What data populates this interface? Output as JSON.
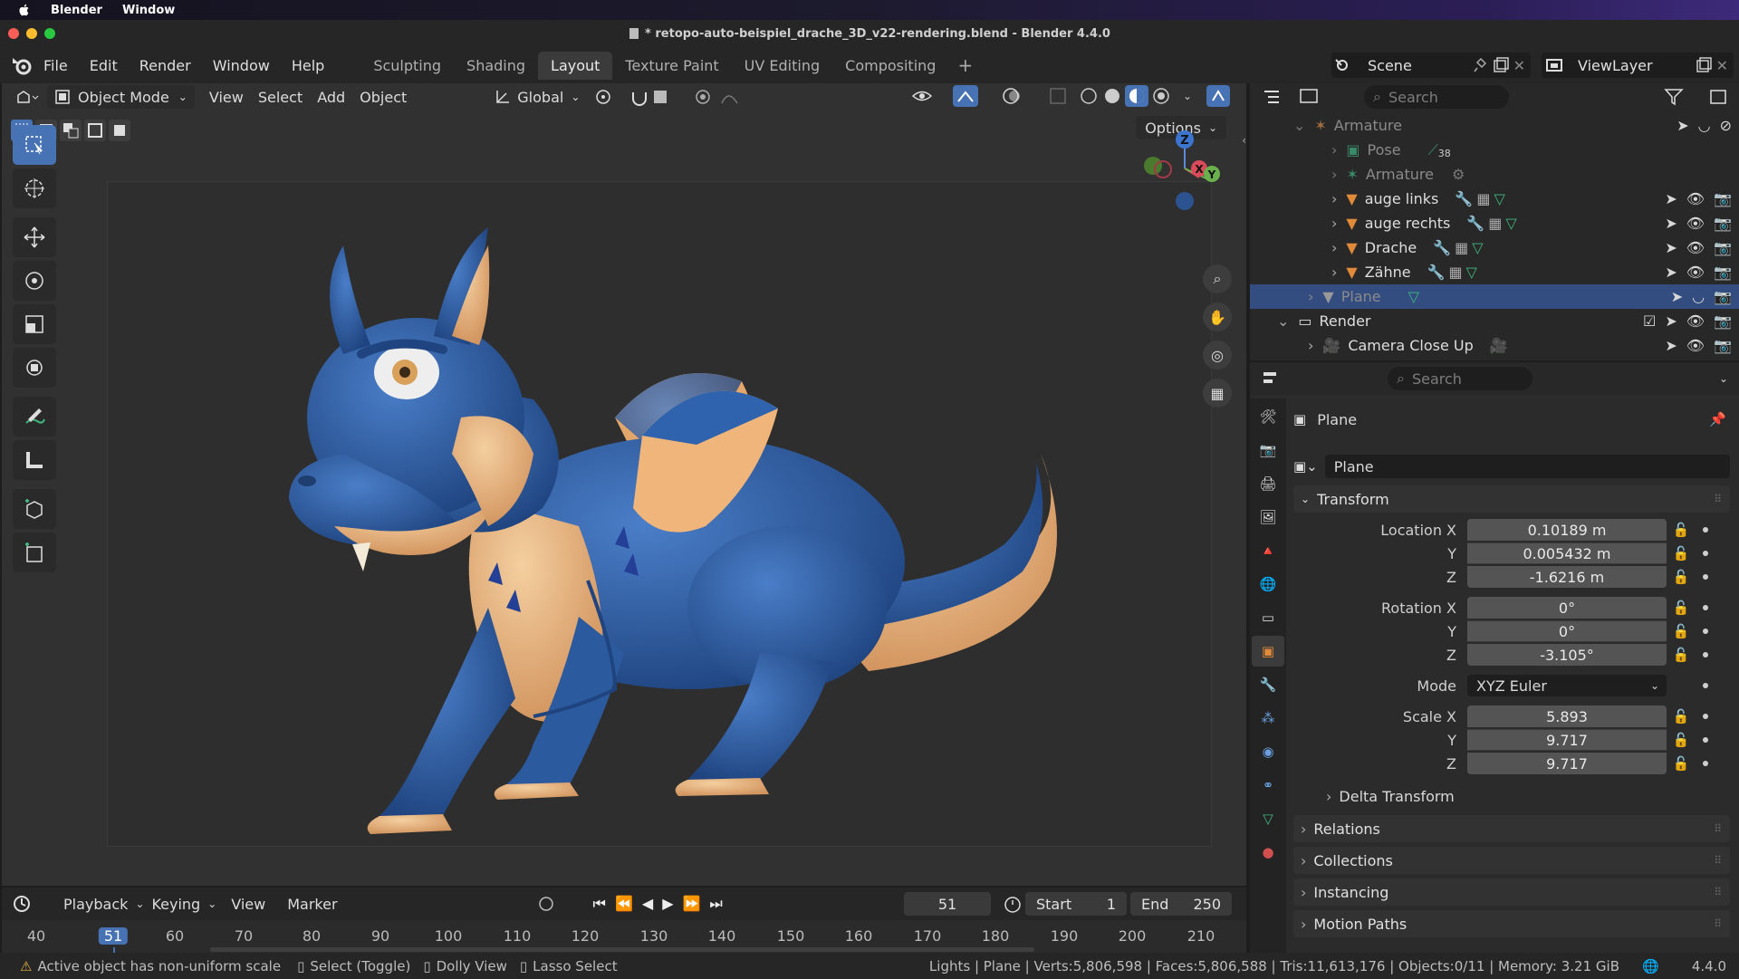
{
  "mac_menu": {
    "app": "Blender",
    "window": "Window"
  },
  "window": {
    "title": "* retopo-auto-beispiel_drache_3D_v22-rendering.blend - Blender 4.4.0"
  },
  "top_menu": {
    "items": [
      "File",
      "Edit",
      "Render",
      "Window",
      "Help"
    ],
    "workspaces": [
      "Sculpting",
      "Shading",
      "Layout",
      "Texture Paint",
      "UV Editing",
      "Compositing"
    ],
    "active_workspace": "Layout",
    "scene": "Scene",
    "view_layer": "ViewLayer"
  },
  "viewport": {
    "mode": "Object Mode",
    "menus": [
      "View",
      "Select",
      "Add",
      "Object"
    ],
    "orientation": "Global",
    "options_label": "Options",
    "gizmo": {
      "z": "Z",
      "x": "X",
      "y": "Y"
    }
  },
  "timeline": {
    "menus": [
      "Playback",
      "Keying",
      "View",
      "Marker"
    ],
    "current_frame": "51",
    "start_label": "Start",
    "start": "1",
    "end_label": "End",
    "end": "250",
    "ticks": [
      "40",
      "51",
      "60",
      "70",
      "80",
      "90",
      "100",
      "110",
      "120",
      "130",
      "140",
      "150",
      "160",
      "170",
      "180",
      "190",
      "200",
      "210"
    ]
  },
  "status_bar": {
    "left": [
      "Active object has non-uniform scale",
      "Select (Toggle)",
      "Dolly View",
      "Lasso Select"
    ],
    "right": "Lights | Plane | Verts:5,806,598 | Faces:5,806,588 | Tris:11,613,176 | Objects:0/11 | Memory: 3.21 GiB",
    "version": "4.4.0"
  },
  "outliner": {
    "search_placeholder": "Search",
    "rows": [
      {
        "name": "Armature",
        "dim": true
      },
      {
        "name": "Pose",
        "dim": true,
        "badge": "38"
      },
      {
        "name": "Armature",
        "dim": true
      },
      {
        "name": "auge links"
      },
      {
        "name": "auge rechts"
      },
      {
        "name": "Drache"
      },
      {
        "name": "Zähne"
      },
      {
        "name": "Plane",
        "selected": true
      },
      {
        "name": "Render"
      },
      {
        "name": "Camera Close Up"
      }
    ]
  },
  "properties": {
    "search_placeholder": "Search",
    "object_name": "Plane",
    "datablock_name": "Plane",
    "transform_label": "Transform",
    "location": {
      "label": "Location X",
      "x": "0.10189 m",
      "y": "0.005432 m",
      "z": "-1.6216 m"
    },
    "rotation": {
      "label": "Rotation X",
      "x": "0°",
      "y": "0°",
      "z": "-3.105°"
    },
    "mode_label": "Mode",
    "mode_value": "XYZ Euler",
    "scale": {
      "label": "Scale X",
      "x": "5.893",
      "y": "9.717",
      "z": "9.717"
    },
    "axis_y": "Y",
    "axis_z": "Z",
    "delta_transform": "Delta Transform",
    "sections": [
      "Relations",
      "Collections",
      "Instancing",
      "Motion Paths"
    ]
  },
  "colors": {
    "accent": "#4772b3",
    "selected_row": "#334d80",
    "dragon_blue": "#2f5fa8",
    "dragon_belly": "#e8b27a"
  }
}
